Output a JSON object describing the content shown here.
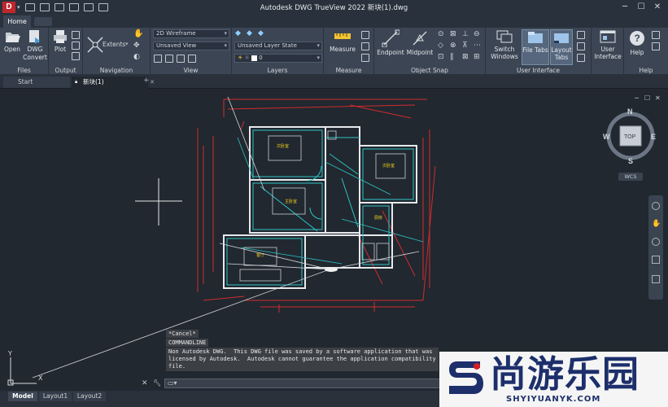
{
  "titlebar": {
    "logo": "D",
    "title": "Autodesk DWG TrueView 2022    新块(1).dwg",
    "minimize": "─",
    "maximize": "☐",
    "close": "✕"
  },
  "tabs": {
    "home": "Home"
  },
  "ribbon": {
    "files": {
      "label": "Files",
      "open": "Open",
      "dwg_convert": "DWG Convert"
    },
    "output": {
      "label": "Output",
      "plot": "Plot"
    },
    "navigation": {
      "label": "Navigation",
      "extents": "Extents"
    },
    "view": {
      "label": "View",
      "visual_style": "2D Wireframe",
      "named_view": "Unsaved View"
    },
    "layers": {
      "label": "Layers",
      "layer_state": "Unsaved Layer State",
      "current_layer": "0"
    },
    "measure": {
      "label": "Measure",
      "measure": "Measure"
    },
    "object_snap": {
      "label": "Object Snap",
      "endpoint": "Endpoint",
      "midpoint": "Midpoint"
    },
    "user_interface": {
      "label": "User Interface",
      "switch_windows": "Switch Windows",
      "file_tabs": "File Tabs",
      "layout_tabs": "Layout Tabs",
      "user_interface": "User Interface"
    },
    "help": {
      "label": "Help",
      "help": "Help"
    }
  },
  "doc_tabs": {
    "start": "Start",
    "file": "新块(1)",
    "add": "+"
  },
  "viewcube": {
    "north": "N",
    "south": "S",
    "east": "E",
    "west": "W",
    "face": "TOP",
    "wcs": "WCS"
  },
  "drawing_labels": [
    "次卧室",
    "主卧室",
    "客厅",
    "厨房"
  ],
  "command": {
    "cancel": "*Cancel*",
    "commandline": "COMMANDLINE",
    "warning": "Non Autodesk DWG.  This DWG file was saved by a software application that was\nlicensed by Autodesk.  Autodesk cannot guarantee the application compatibility\nfile."
  },
  "layouts": {
    "model": "Model",
    "layout1": "Layout1",
    "layout2": "Layout2"
  },
  "ucs": {
    "y": "Y",
    "x": "X"
  },
  "watermark": {
    "cn": "尚游乐园",
    "en": "SHYIYUANYK.COM"
  },
  "colors": {
    "accent_red": "#c0272d",
    "cyan_lines": "#2ec4c4",
    "red_lines": "#d22b2b",
    "watermark_blue": "#1d2f6b"
  }
}
